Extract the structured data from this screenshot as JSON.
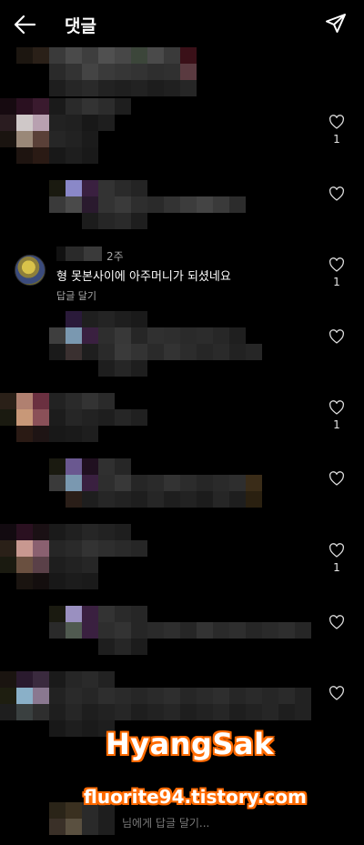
{
  "header": {
    "title": "댓글",
    "back_icon": "arrow-left-icon",
    "send_icon": "paper-plane-icon"
  },
  "comment": {
    "time": "2주",
    "text": "형 못본사이에 아주머니가 되셨네요",
    "reply_label": "답글 달기"
  },
  "like_counts": [
    "1",
    "1",
    "1",
    "1"
  ],
  "input": {
    "placeholder": "님에게 답글 달기..."
  },
  "watermark": {
    "line1": "HyangSak",
    "line2": "fluorite94.tistory.com"
  },
  "colors": {
    "background": "#000000",
    "text": "#ffffff",
    "secondary_text": "#a8a8a8",
    "watermark_outline": "#ff6a00"
  }
}
